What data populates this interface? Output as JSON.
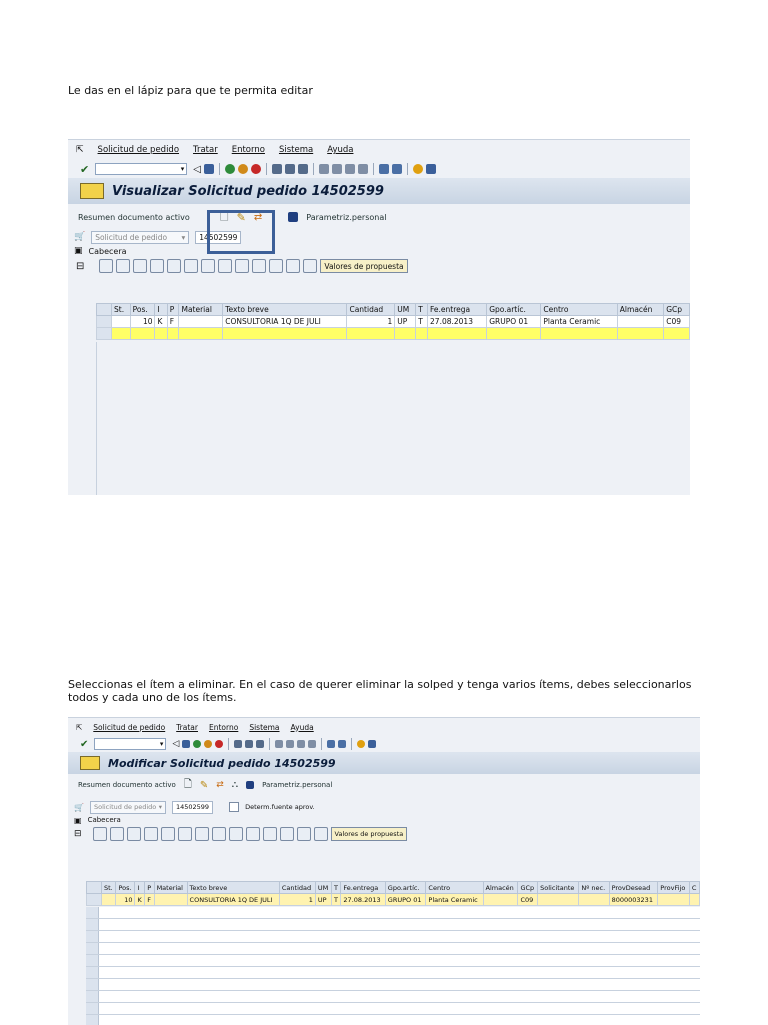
{
  "para1": "Le das en el lápiz para que te permita editar",
  "para2": "Seleccionas el ítem a eliminar.  En el caso de querer eliminar la solped y tenga varios ítems, debes seleccionarlos todos y cada uno de los ítems.",
  "menu": [
    "Solicitud de pedido",
    "Tratar",
    "Entorno",
    "Sistema",
    "Ayuda"
  ],
  "shot1": {
    "title": "Visualizar Solicitud pedido 14502599",
    "resumen": "Resumen documento activo",
    "param": "Parametriz.personal",
    "doc_type_placeholder": "Solicitud de pedido",
    "doc_number": "14502599",
    "cabecera": "Cabecera",
    "valores": "Valores de propuesta",
    "columns": [
      "St.",
      "Pos.",
      "I",
      "P",
      "Material",
      "Texto breve",
      "Cantidad",
      "UM",
      "T",
      "Fe.entrega",
      "Gpo.artíc.",
      "Centro",
      "Almacén",
      "GCp"
    ],
    "row": [
      "",
      "10",
      "K",
      "F",
      "",
      "CONSULTORIA 1Q DE JULI",
      "1",
      "UP",
      "T",
      "27.08.2013",
      "GRUPO 01",
      "Planta Ceramic",
      "",
      "C09"
    ]
  },
  "shot2": {
    "title": "Modificar Solicitud pedido 14502599",
    "resumen": "Resumen documento activo",
    "param": "Parametriz.personal",
    "doc_type_placeholder": "Solicitud de pedido",
    "doc_number": "14502599",
    "determ": "Determ.fuente aprov.",
    "cabecera": "Cabecera",
    "valores": "Valores de propuesta",
    "columns": [
      "St.",
      "Pos.",
      "I",
      "P",
      "Material",
      "Texto breve",
      "Cantidad",
      "UM",
      "T",
      "Fe.entrega",
      "Gpo.artíc.",
      "Centro",
      "Almacén",
      "GCp",
      "Solicitante",
      "Nº nec.",
      "ProvDesead",
      "ProvFijo",
      "C"
    ],
    "row": [
      "",
      "10",
      "K",
      "F",
      "",
      "CONSULTORIA 1Q DE JULI",
      "1",
      "UP",
      "T",
      "27.08.2013",
      "GRUPO 01",
      "Planta Ceramic",
      "",
      "C09",
      "",
      "",
      "8000003231",
      "",
      ""
    ]
  }
}
